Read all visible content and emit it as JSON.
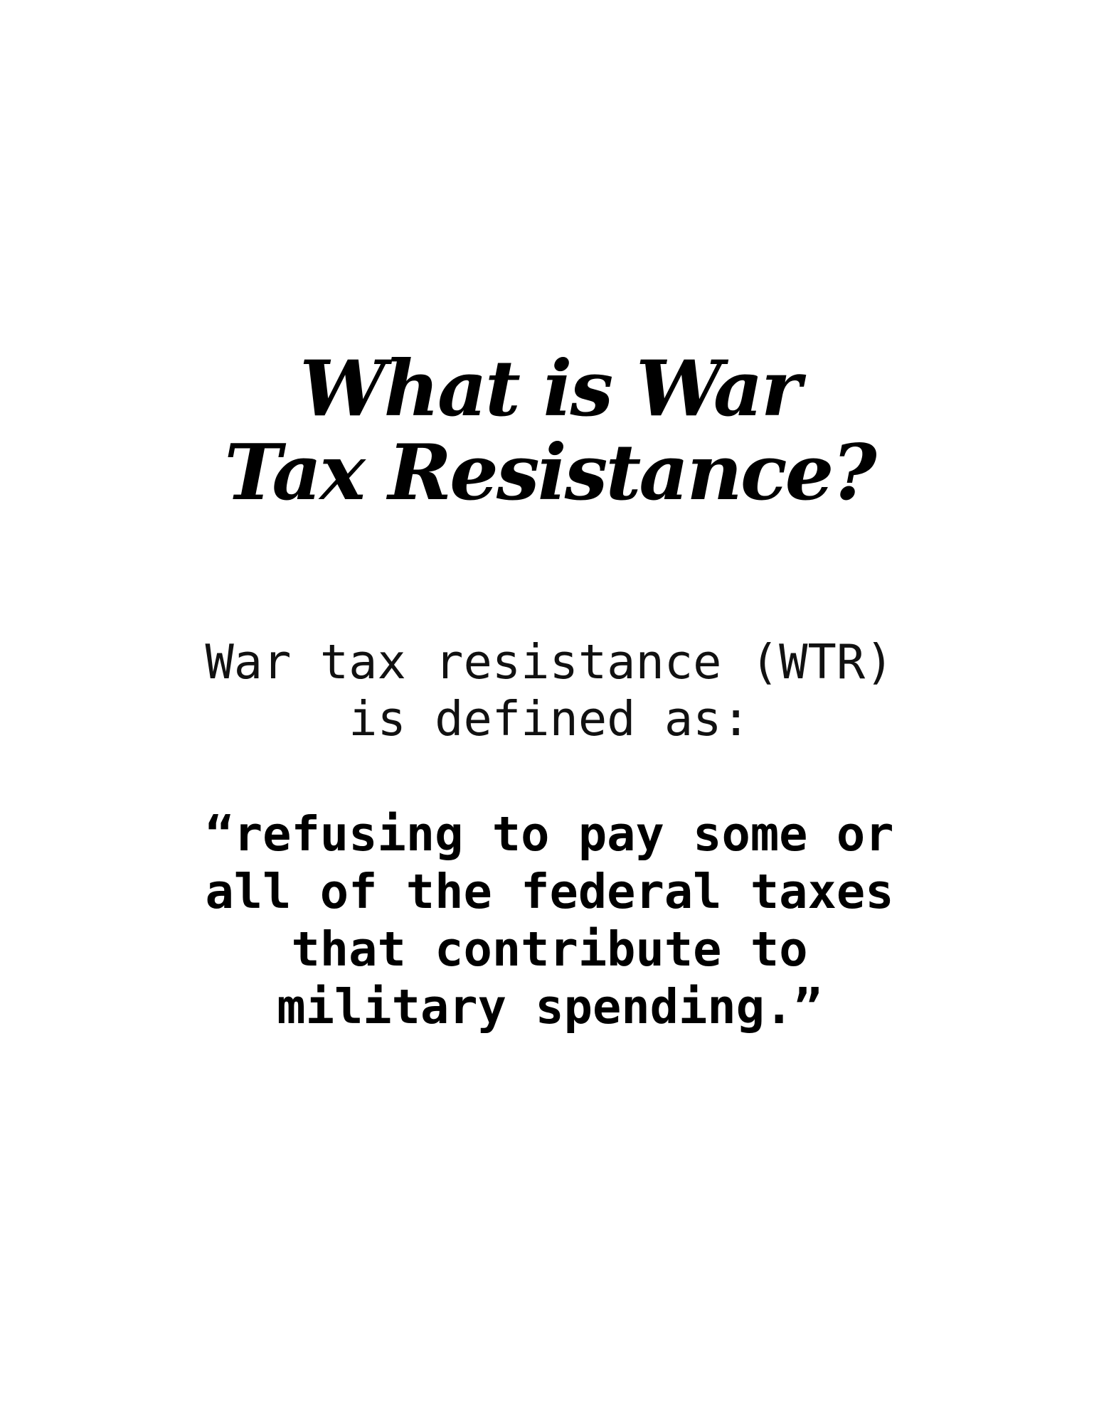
{
  "document": {
    "title_lines": [
      "What is War",
      "Tax Resistance?"
    ],
    "intro_lines": [
      "War tax resistance (WTR)",
      "is defined as:"
    ],
    "quote_lines": [
      "“refusing to pay some or",
      "all of the federal taxes",
      "that contribute to",
      "military spending.”"
    ]
  }
}
